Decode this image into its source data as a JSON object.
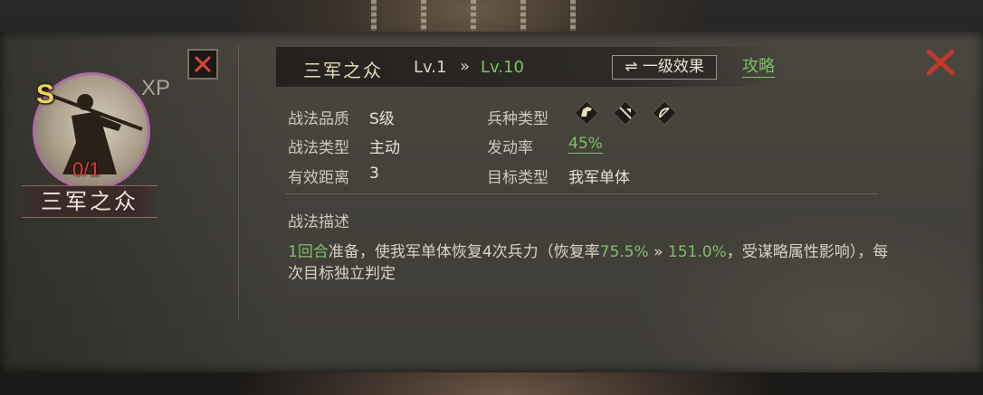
{
  "general": {
    "grade": "S",
    "xp_label": "XP",
    "count": "0/1",
    "skill_name_plate": "三军之众"
  },
  "header": {
    "skill_title": "三军之众",
    "level_from": "Lv.1",
    "level_arrow": "»",
    "level_to": "Lv.10",
    "effect_button": "⇌ 一级效果",
    "guide_link": "攻略"
  },
  "attributes": {
    "quality_label": "战法品质",
    "quality_value": "S级",
    "type_label": "战法类型",
    "type_value": "主动",
    "range_label": "有效距离",
    "range_value": "3",
    "troop_label": "兵种类型",
    "troop_icons": [
      "cavalry-icon",
      "shield-icon",
      "archer-icon"
    ],
    "rate_label": "发动率",
    "rate_value": "45%",
    "target_label": "目标类型",
    "target_value": "我军单体"
  },
  "description": {
    "title": "战法描述",
    "part1_green": "1回合",
    "part2": "准备，使我军单体恢复4次兵力（恢复率",
    "part3_green": "75.5%",
    "part4": " » ",
    "part5_green": "151.0%",
    "part6": "，受谋略属性影响），每次目标独立判定"
  },
  "colors": {
    "accent_green": "#7fbf6a",
    "close_red": "#c0392b",
    "grade_gold": "#f2d05a",
    "count_red": "#d8433a",
    "avatar_border": "#b06aa7"
  }
}
